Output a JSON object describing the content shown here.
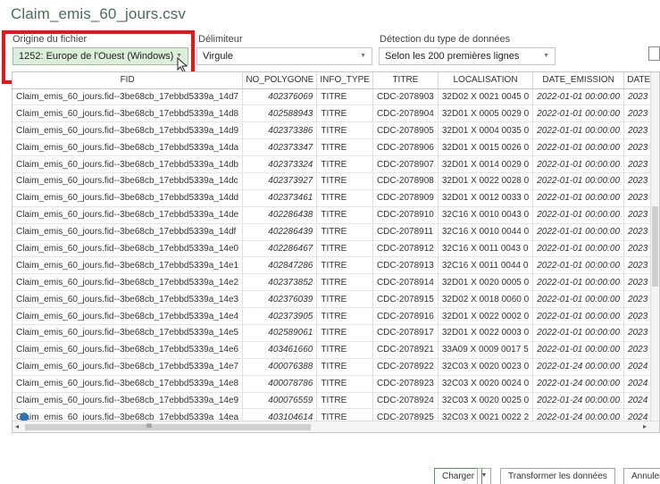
{
  "title": "Claim_emis_60_jours.csv",
  "origin": {
    "label": "Origine du fichier",
    "value": "1252: Europe de l'Ouest (Windows)"
  },
  "delimiter": {
    "label": "Délimiteur",
    "value": "Virgule"
  },
  "detection": {
    "label": "Détection du type de données",
    "value": "Selon les 200 premières lignes"
  },
  "columns": [
    "FID",
    "NO_POLYGONE",
    "INFO_TYPE",
    "TITRE",
    "LOCALISATION",
    "DATE_EMISSION",
    "DATE_"
  ],
  "rows": [
    [
      "Claim_emis_60_jours.fid--3be68cb_17ebbd5339a_14d7",
      "402376069",
      "TITRE",
      "CDC-2078903",
      "32D02 X 0021 0045 0",
      "2022-01-01 00:00:00",
      "2023"
    ],
    [
      "Claim_emis_60_jours.fid--3be68cb_17ebbd5339a_14d8",
      "402588943",
      "TITRE",
      "CDC-2078904",
      "32D01 X 0005 0029 0",
      "2022-01-01 00:00:00",
      "2023"
    ],
    [
      "Claim_emis_60_jours.fid--3be68cb_17ebbd5339a_14d9",
      "402373386",
      "TITRE",
      "CDC-2078905",
      "32D01 X 0004 0035 0",
      "2022-01-01 00:00:00",
      "2023"
    ],
    [
      "Claim_emis_60_jours.fid--3be68cb_17ebbd5339a_14da",
      "402373347",
      "TITRE",
      "CDC-2078906",
      "32D01 X 0015 0026 0",
      "2022-01-01 00:00:00",
      "2023"
    ],
    [
      "Claim_emis_60_jours.fid--3be68cb_17ebbd5339a_14db",
      "402373324",
      "TITRE",
      "CDC-2078907",
      "32D01 X 0014 0029 0",
      "2022-01-01 00:00:00",
      "2023"
    ],
    [
      "Claim_emis_60_jours.fid--3be68cb_17ebbd5339a_14dc",
      "402373927",
      "TITRE",
      "CDC-2078908",
      "32D01 X 0022 0028 0",
      "2022-01-01 00:00:00",
      "2023"
    ],
    [
      "Claim_emis_60_jours.fid--3be68cb_17ebbd5339a_14dd",
      "402373461",
      "TITRE",
      "CDC-2078909",
      "32D01 X 0012 0033 0",
      "2022-01-01 00:00:00",
      "2023"
    ],
    [
      "Claim_emis_60_jours.fid--3be68cb_17ebbd5339a_14de",
      "402286438",
      "TITRE",
      "CDC-2078910",
      "32C16 X 0010 0043 0",
      "2022-01-01 00:00:00",
      "2023"
    ],
    [
      "Claim_emis_60_jours.fid--3be68cb_17ebbd5339a_14df",
      "402286439",
      "TITRE",
      "CDC-2078911",
      "32C16 X 0010 0044 0",
      "2022-01-01 00:00:00",
      "2023"
    ],
    [
      "Claim_emis_60_jours.fid--3be68cb_17ebbd5339a_14e0",
      "402286467",
      "TITRE",
      "CDC-2078912",
      "32C16 X 0011 0043 0",
      "2022-01-01 00:00:00",
      "2023"
    ],
    [
      "Claim_emis_60_jours.fid--3be68cb_17ebbd5339a_14e1",
      "402847286",
      "TITRE",
      "CDC-2078913",
      "32C16 X 0011 0044 0",
      "2022-01-01 00:00:00",
      "2023"
    ],
    [
      "Claim_emis_60_jours.fid--3be68cb_17ebbd5339a_14e2",
      "402373852",
      "TITRE",
      "CDC-2078914",
      "32D01 X 0020 0005 0",
      "2022-01-01 00:00:00",
      "2023"
    ],
    [
      "Claim_emis_60_jours.fid--3be68cb_17ebbd5339a_14e3",
      "402376039",
      "TITRE",
      "CDC-2078915",
      "32D02 X 0018 0060 0",
      "2022-01-01 00:00:00",
      "2023"
    ],
    [
      "Claim_emis_60_jours.fid--3be68cb_17ebbd5339a_14e4",
      "402373905",
      "TITRE",
      "CDC-2078916",
      "32D01 X 0022 0002 0",
      "2022-01-01 00:00:00",
      "2023"
    ],
    [
      "Claim_emis_60_jours.fid--3be68cb_17ebbd5339a_14e5",
      "402589061",
      "TITRE",
      "CDC-2078917",
      "32D01 X 0022 0003 0",
      "2022-01-01 00:00:00",
      "2023"
    ],
    [
      "Claim_emis_60_jours.fid--3be68cb_17ebbd5339a_14e6",
      "403461660",
      "TITRE",
      "CDC-2078921",
      "33A09 X 0009 0017 5",
      "2022-01-01 00:00:00",
      "2023"
    ],
    [
      "Claim_emis_60_jours.fid--3be68cb_17ebbd5339a_14e7",
      "400076388",
      "TITRE",
      "CDC-2078922",
      "32C03 X 0020 0023 0",
      "2022-01-24 00:00:00",
      "2024"
    ],
    [
      "Claim_emis_60_jours.fid--3be68cb_17ebbd5339a_14e8",
      "400078786",
      "TITRE",
      "CDC-2078923",
      "32C03 X 0020 0024 0",
      "2022-01-24 00:00:00",
      "2024"
    ],
    [
      "Claim_emis_60_jours.fid--3be68cb_17ebbd5339a_14e9",
      "400076559",
      "TITRE",
      "CDC-2078924",
      "32C03 X 0020 0025 0",
      "2022-01-24 00:00:00",
      "2024"
    ],
    [
      "Claim_emis_60_jours.fid--3be68cb_17ebbd5339a_14ea",
      "403104614",
      "TITRE",
      "CDC-2078925",
      "32C03 X 0021 0022 2",
      "2022-01-24 00:00:00",
      "2024"
    ]
  ],
  "buttons": {
    "load": "Charger",
    "transform": "Transformer les données",
    "cancel": "Annuler"
  },
  "colors": {
    "title": "#4a6d59",
    "highlight_box": "#e8131b",
    "selected_field": "#dcefdc"
  }
}
